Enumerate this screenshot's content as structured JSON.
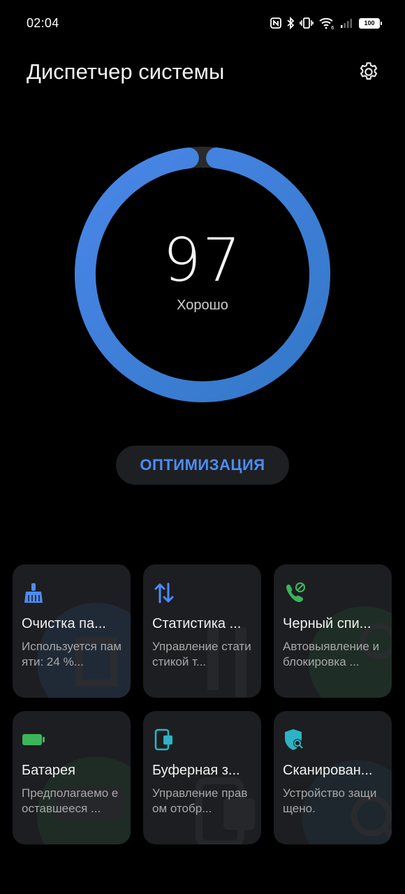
{
  "status_bar": {
    "time": "02:04",
    "battery": "100",
    "icons": [
      "nfc-icon",
      "bluetooth-icon",
      "vibrate-icon",
      "wifi-icon",
      "signal-icon",
      "battery-icon"
    ]
  },
  "header": {
    "title": "Диспетчер системы",
    "settings_icon": "gear-icon"
  },
  "score": {
    "value": "97",
    "label": "Хорошо",
    "ring_fraction": 0.97,
    "colors": {
      "start": "#4a86e8",
      "end": "#3378c8",
      "track": "#2a2a2a"
    }
  },
  "optimize_button": {
    "label": "ОПТИМИЗАЦИЯ",
    "color": "#4d8cf5"
  },
  "tiles": [
    {
      "title": "Очистка па...",
      "desc": "Используется памяти: 24 %...",
      "icon": "broom-icon",
      "accent": "#4d8cf5"
    },
    {
      "title": "Статистика ...",
      "desc": "Управление статистикой т...",
      "icon": "data-transfer-icon",
      "accent": "#4d8cf5"
    },
    {
      "title": "Черный спи...",
      "desc": "Автовыявление и блокировка ...",
      "icon": "phone-block-icon",
      "accent": "#3cb45a"
    },
    {
      "title": "Батарея",
      "desc": "Предполагаемо е оставшееся ...",
      "icon": "battery-icon",
      "accent": "#3cb45a"
    },
    {
      "title": "Буферная з...",
      "desc": "Управление правом отобр...",
      "icon": "clipboard-icon",
      "accent": "#2db3c4"
    },
    {
      "title": "Сканирован...",
      "desc": "Устройство защищено.",
      "icon": "shield-scan-icon",
      "accent": "#2db3c4"
    }
  ]
}
